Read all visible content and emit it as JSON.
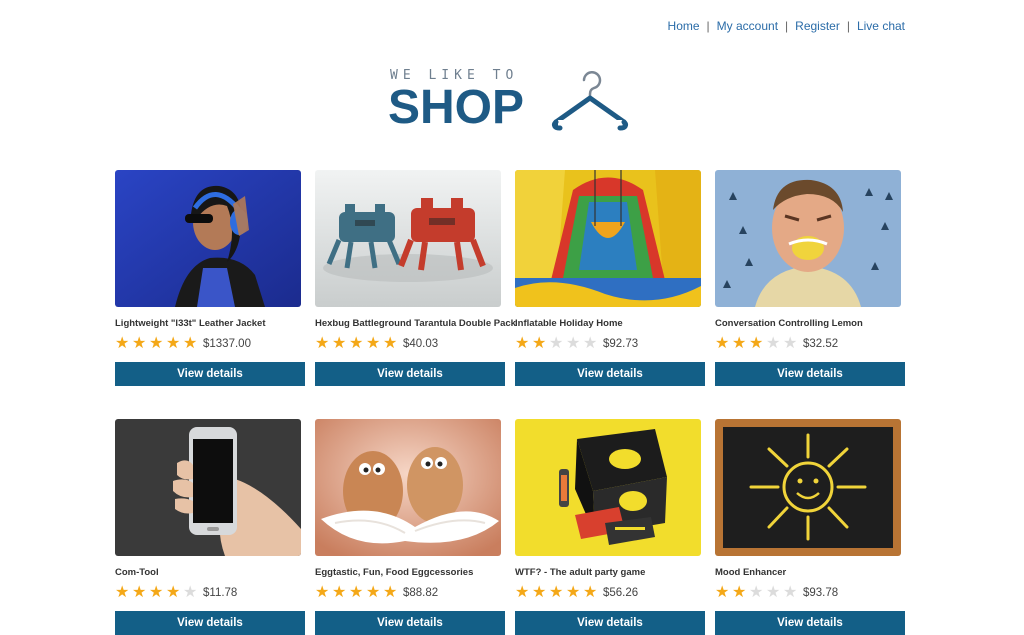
{
  "nav": {
    "home": "Home",
    "account": "My account",
    "register": "Register",
    "chat": "Live chat",
    "separator": "|"
  },
  "logo": {
    "tagline": "WE LIKE TO",
    "word": "SHOP"
  },
  "colors": {
    "brand": "#1e5a85",
    "button": "#135f87",
    "star_on": "#f4a818",
    "star_off": "#dcdcdc",
    "link": "#2b6ca8"
  },
  "products": [
    {
      "title": "Lightweight \"l33t\" Leather Jacket",
      "rating": 5,
      "price": "$1337.00",
      "button": "View details"
    },
    {
      "title": "Hexbug Battleground Tarantula Double Pack",
      "rating": 5,
      "price": "$40.03",
      "button": "View details"
    },
    {
      "title": "Inflatable Holiday Home",
      "rating": 2,
      "price": "$92.73",
      "button": "View details"
    },
    {
      "title": "Conversation Controlling Lemon",
      "rating": 3,
      "price": "$32.52",
      "button": "View details"
    },
    {
      "title": "Com-Tool",
      "rating": 4,
      "price": "$11.78",
      "button": "View details"
    },
    {
      "title": "Eggtastic, Fun, Food Eggcessories",
      "rating": 5,
      "price": "$88.82",
      "button": "View details"
    },
    {
      "title": "WTF? - The adult party game",
      "rating": 5,
      "price": "$56.26",
      "button": "View details"
    },
    {
      "title": "Mood Enhancer",
      "rating": 2,
      "price": "$93.78",
      "button": "View details"
    }
  ]
}
